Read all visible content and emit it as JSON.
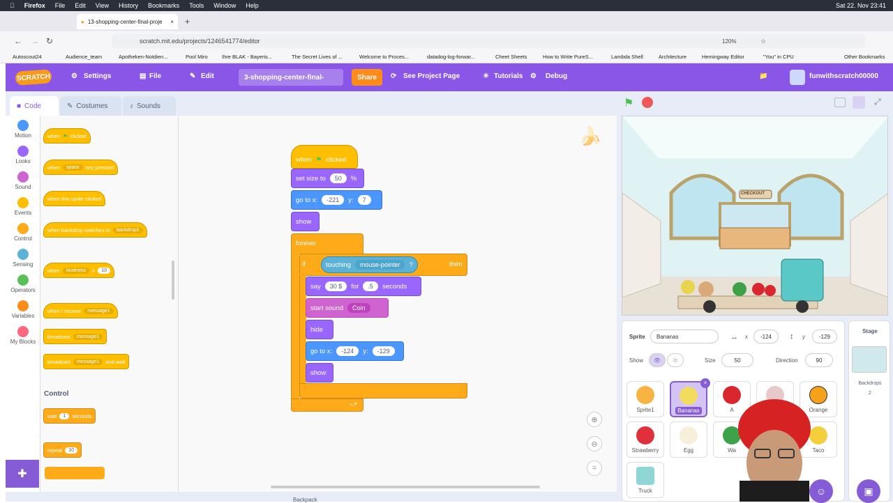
{
  "macbar": {
    "app": "Firefox",
    "menus": [
      "File",
      "Edit",
      "View",
      "History",
      "Bookmarks",
      "Tools",
      "Window",
      "Help"
    ],
    "datetime": "Sat 22. Nov 23:41"
  },
  "browser": {
    "tab_title": "13-shopping-center-final-proje",
    "url": "scratch.mit.edu/projects/1246541774/editor",
    "zoom": "120%",
    "bookmarks": [
      "Autoscout24",
      "Audience_team",
      "Apotheken-Notdien...",
      "Pool Miro",
      "Ihre BLAK - Bayeris...",
      "The Secret Lives of ...",
      "Welcome to Proces...",
      "datadog-log-forwar...",
      "Cheet Sheets",
      "How to Write PureS...",
      "Lambda Shell",
      "Architecture",
      "Hemingway Editor",
      "\"You\" in CPU"
    ],
    "other_bookmarks": "Other Bookmarks"
  },
  "menu": {
    "logo": "SCRATCH",
    "settings": "Settings",
    "file": "File",
    "edit": "Edit",
    "project_title": "3-shopping-center-final-",
    "share": "Share",
    "see_project": "See Project Page",
    "tutorials": "Tutorials",
    "debug": "Debug",
    "username": "funwithscratch00000"
  },
  "tabs": {
    "code": "Code",
    "costumes": "Costumes",
    "sounds": "Sounds"
  },
  "categories": [
    {
      "label": "Motion",
      "color": "#4c97ff"
    },
    {
      "label": "Looks",
      "color": "#9966ff"
    },
    {
      "label": "Sound",
      "color": "#cf63cf"
    },
    {
      "label": "Events",
      "color": "#ffbf00"
    },
    {
      "label": "Control",
      "color": "#ffab19"
    },
    {
      "label": "Sensing",
      "color": "#5cb1d6"
    },
    {
      "label": "Operators",
      "color": "#59c059"
    },
    {
      "label": "Variables",
      "color": "#ff8c1a"
    },
    {
      "label": "My Blocks",
      "color": "#ff6680"
    }
  ],
  "palette": {
    "when": "when",
    "clicked": "clicked",
    "space": "space",
    "key_pressed": "key pressed",
    "sprite_clicked": "when this sprite clicked",
    "backdrop_switch": "when backdrop switches to",
    "backdrop1": "backdrop1",
    "loudness": "loudness",
    "gt": ">",
    "ten": "10",
    "receive": "when I receive",
    "message1": "message1",
    "broadcast": "broadcast",
    "and_wait": "and wait",
    "control_header": "Control",
    "wait": "wait",
    "one": "1",
    "seconds": "seconds",
    "repeat": "repeat"
  },
  "script": {
    "when": "when",
    "clicked": "clicked",
    "set_size": "set size to",
    "size_val": "50",
    "pct": "%",
    "goto": "go to x:",
    "x1": "-221",
    "y": "y:",
    "y1": "7",
    "show": "show",
    "forever": "forever",
    "if": "if",
    "touching": "touching",
    "mouse_pointer": "mouse-pointer",
    "q": "?",
    "then": "then",
    "say": "say",
    "say_val": "30 $",
    "for": "for",
    "dur": ".5",
    "seconds": "seconds",
    "start_sound": "start sound",
    "coin": "Coin",
    "hide": "hide",
    "x2": "-124",
    "y2": "-129",
    "show2": "show"
  },
  "stage": {
    "checkout": "CHECKOUT"
  },
  "sprite_info": {
    "sprite_label": "Sprite",
    "sprite_name": "Bananas",
    "x_label": "x",
    "x": "-124",
    "y_label": "y",
    "y": "-129",
    "show_label": "Show",
    "size_label": "Size",
    "size": "50",
    "direction_label": "Direction",
    "direction": "90"
  },
  "sprites": [
    "Sprite1",
    "Bananas",
    "A",
    "",
    "Orange",
    "Strawberry",
    "Egg",
    "Wa",
    "",
    "Taco",
    "Truck"
  ],
  "stage_panel": {
    "title": "Stage",
    "backdrops_label": "Backdrops",
    "backdrops_count": "2"
  },
  "footer": {
    "backpack": "Backpack"
  }
}
